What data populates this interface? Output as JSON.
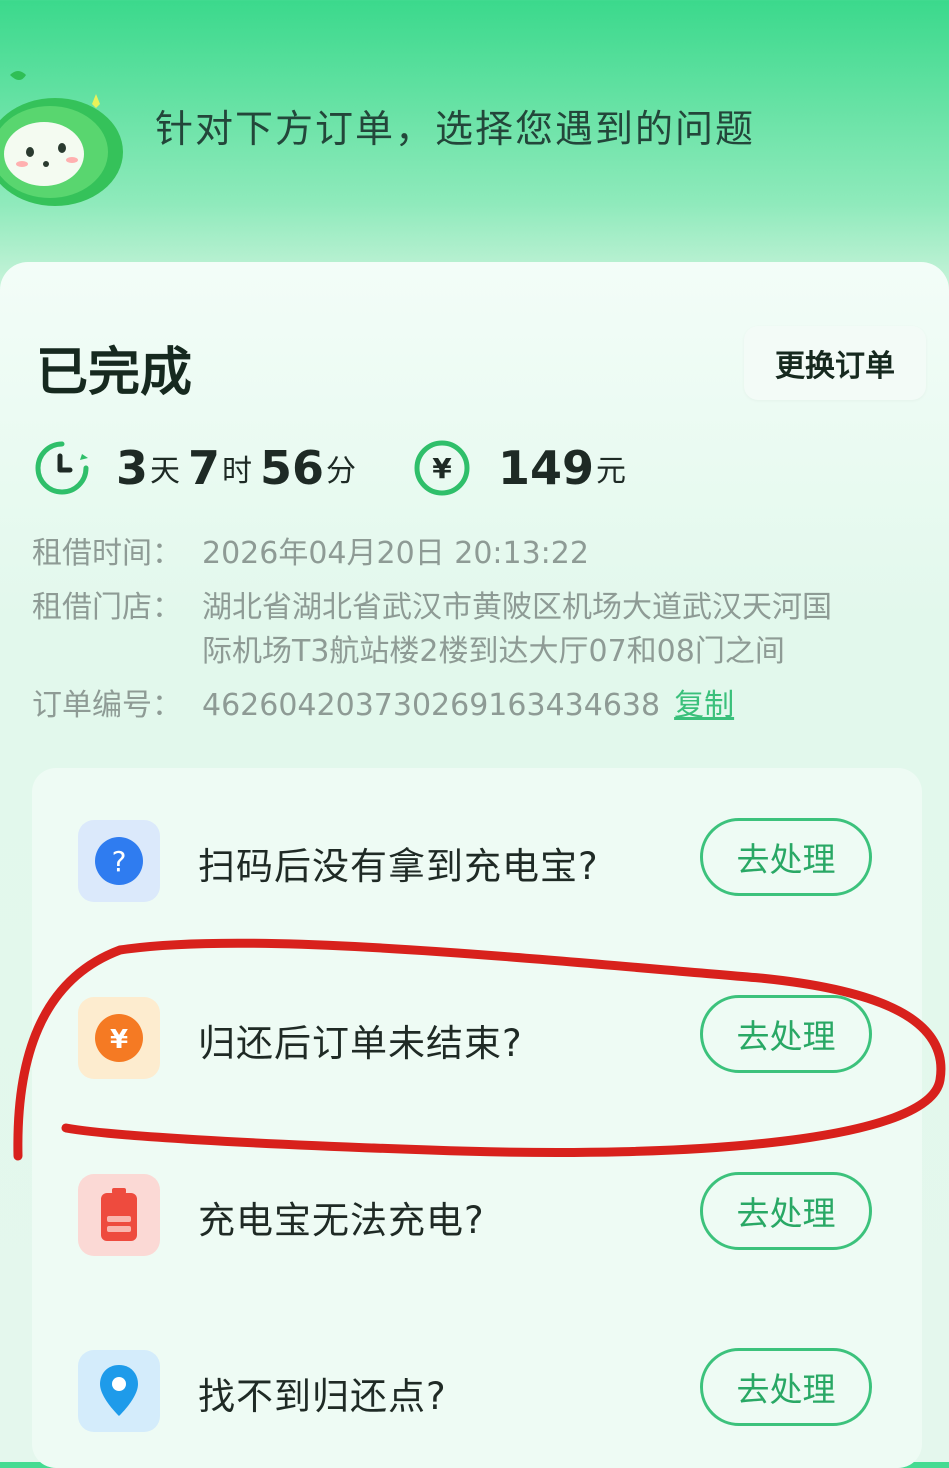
{
  "header": {
    "title": "针对下方订单，选择您遇到的问题"
  },
  "order": {
    "status": "已完成",
    "change_label": "更换订单",
    "duration": {
      "days": "3",
      "days_unit": "天",
      "hours": "7",
      "hours_unit": "时",
      "minutes": "56",
      "minutes_unit": "分"
    },
    "amount": {
      "value": "149",
      "unit": "元",
      "currency_symbol": "¥"
    },
    "rent_time_label": "租借时间：",
    "rent_time": "2026年04月20日 20:13:22",
    "store_label": "租借门店：",
    "store_line1": "湖北省湖北省武汉市黄陂区机场大道武汉天河国",
    "store_line2": "际机场T3航站楼2楼到达大厅07和08门之间",
    "order_no_label": "订单编号：",
    "order_no": "4626042037302691634346​38",
    "copy_label": "复制"
  },
  "issues": [
    {
      "label": "扫码后没有拿到充电宝?",
      "icon": "question-icon",
      "action": "去处理"
    },
    {
      "label": "归还后订单未结束?",
      "icon": "yuan-icon",
      "action": "去处理"
    },
    {
      "label": "充电宝无法充电?",
      "icon": "battery-icon",
      "action": "去处理"
    },
    {
      "label": "找不到归还点?",
      "icon": "location-pin-icon",
      "action": "去处理"
    }
  ],
  "colors": {
    "accent_green": "#3cc27c",
    "annotation_red": "#d8211c"
  }
}
